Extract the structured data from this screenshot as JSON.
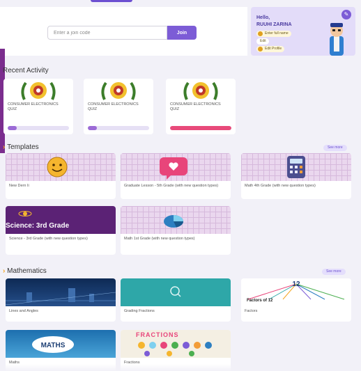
{
  "join": {
    "placeholder": "Enter a join code",
    "button_label": "Join"
  },
  "profile": {
    "greeting": "Hello,",
    "name": "RUUHI ZARINA",
    "chips": [
      "Enter full name",
      "Edit",
      "Edit Profile"
    ]
  },
  "recent_activity": {
    "title": "Recent Activity",
    "items": [
      {
        "title": "CONSUMER ELECTRONICS QUIZ",
        "progress": 0.15,
        "color": "#9c6bd6"
      },
      {
        "title": "CONSUMER ELECTRONICS QUIZ",
        "progress": 0.15,
        "color": "#9c6bd6"
      },
      {
        "title": "CONSUMER ELECTRONICS QUIZ",
        "progress": 1.0,
        "color": "#e84a7a"
      }
    ]
  },
  "templates": {
    "title": "Templates",
    "see_more": "See more",
    "items": [
      {
        "label": "New Dern Ii"
      },
      {
        "label": "Graduate Lesson - 5th Grade (with new question types)"
      },
      {
        "label": "Math 4th Grade (with new question types)"
      },
      {
        "label": "Science - 3rd Grade (with new question types)",
        "banner": "Science: 3rd Grade"
      },
      {
        "label": "Math 1st Grade (with new question types)"
      }
    ]
  },
  "mathematics": {
    "title": "Mathematics",
    "see_more": "See more",
    "items": [
      {
        "label": "Lines and Angles"
      },
      {
        "label": "Grading Fractions"
      },
      {
        "label": "Factors",
        "banner": "Factors of 12",
        "number": "12"
      },
      {
        "label": "Maths",
        "banner": "MATHS"
      },
      {
        "label": "Fractions",
        "banner": "FRACTIONS"
      }
    ]
  }
}
